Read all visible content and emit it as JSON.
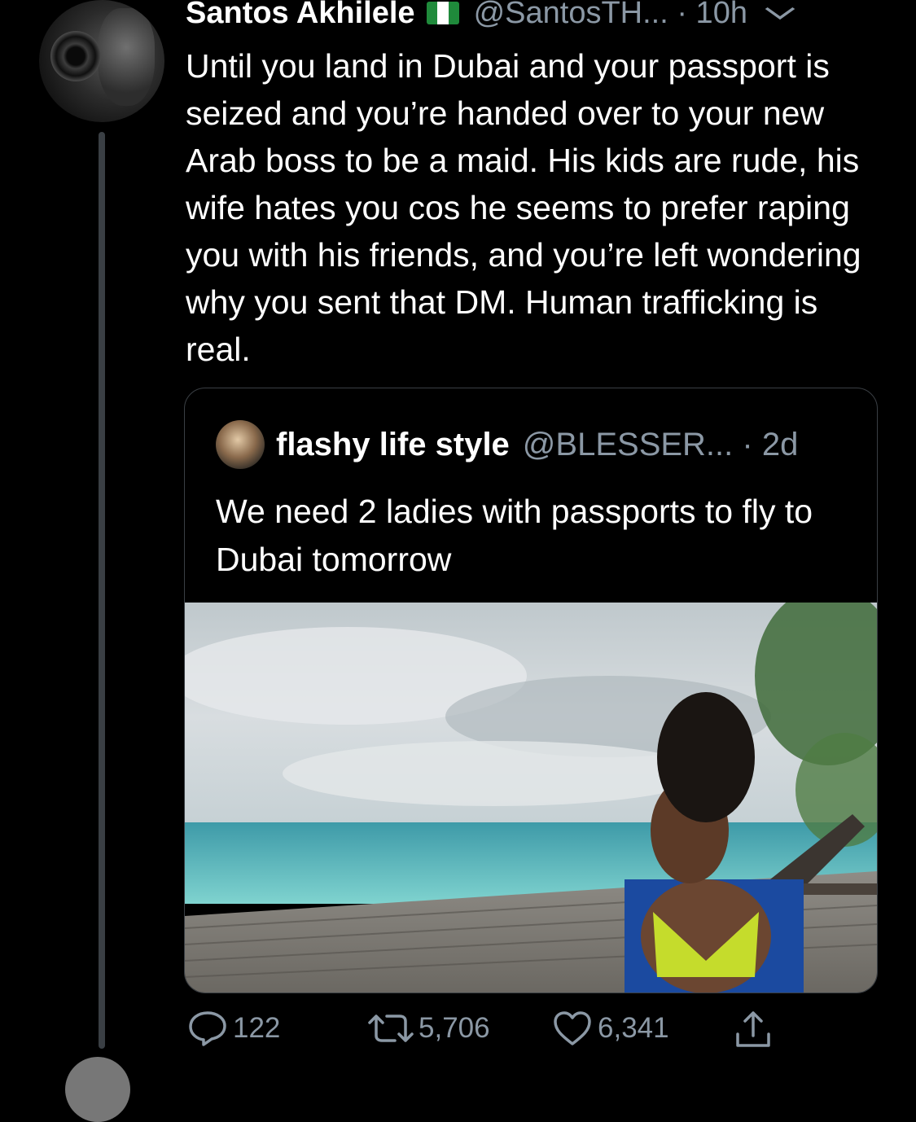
{
  "tweet": {
    "author_name": "Santos Akhilele",
    "handle_time": "@SantosTH... · 10h",
    "text": "Until you land in Dubai and your passport is seized and you’re handed over to your new Arab boss to be a maid. His kids are rude, his wife hates you cos he seems to prefer raping you with his friends, and you’re left wondering why you sent that DM. Human trafficking is real."
  },
  "quote": {
    "author_name": "flashy life style",
    "handle_time": "@BLESSER... · 2d",
    "text": "We need 2 ladies with passports to fly to Dubai tomorrow"
  },
  "actions": {
    "replies": "122",
    "retweets": "5,706",
    "likes": "6,341"
  },
  "colors": {
    "background": "#000000",
    "secondary_text": "#8b98a5",
    "border": "#3a3f44"
  },
  "icons": [
    "chevron-down-icon",
    "reply-icon",
    "retweet-icon",
    "like-icon",
    "share-icon",
    "nigeria-flag-icon"
  ]
}
